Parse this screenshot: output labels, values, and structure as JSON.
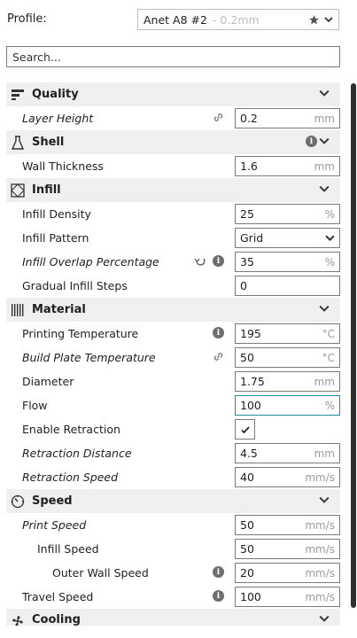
{
  "profile": {
    "label": "Profile:",
    "name": "Anet A8 #2",
    "variant": "- 0.2mm"
  },
  "search": {
    "placeholder": "Search..."
  },
  "sections": {
    "quality": "Quality",
    "shell": "Shell",
    "infill": "Infill",
    "material": "Material",
    "speed": "Speed",
    "cooling": "Cooling"
  },
  "settings": {
    "layer_height": {
      "label": "Layer Height",
      "value": "0.2",
      "unit": "mm"
    },
    "wall_thickness": {
      "label": "Wall Thickness",
      "value": "1.6",
      "unit": "mm"
    },
    "infill_density": {
      "label": "Infill Density",
      "value": "25",
      "unit": "%"
    },
    "infill_pattern": {
      "label": "Infill Pattern",
      "value": "Grid"
    },
    "infill_overlap": {
      "label": "Infill Overlap Percentage",
      "value": "35",
      "unit": "%"
    },
    "gradual_infill": {
      "label": "Gradual Infill Steps",
      "value": "0"
    },
    "printing_temp": {
      "label": "Printing Temperature",
      "value": "195",
      "unit": "°C"
    },
    "build_plate_temp": {
      "label": "Build Plate Temperature",
      "value": "50",
      "unit": "°C"
    },
    "diameter": {
      "label": "Diameter",
      "value": "1.75",
      "unit": "mm"
    },
    "flow": {
      "label": "Flow",
      "value": "100",
      "unit": "%"
    },
    "enable_retraction": {
      "label": "Enable Retraction",
      "checked": true
    },
    "retraction_distance": {
      "label": "Retraction Distance",
      "value": "4.5",
      "unit": "mm"
    },
    "retraction_speed": {
      "label": "Retraction Speed",
      "value": "40",
      "unit": "mm/s"
    },
    "print_speed": {
      "label": "Print Speed",
      "value": "50",
      "unit": "mm/s"
    },
    "infill_speed": {
      "label": "Infill Speed",
      "value": "50",
      "unit": "mm/s"
    },
    "outer_wall_speed": {
      "label": "Outer Wall Speed",
      "value": "20",
      "unit": "mm/s"
    },
    "travel_speed": {
      "label": "Travel Speed",
      "value": "100",
      "unit": "mm/s"
    }
  },
  "colors": {
    "accent": "#1f8aa8",
    "section_bg": "#efefef",
    "icon": "#6e6e6e"
  }
}
